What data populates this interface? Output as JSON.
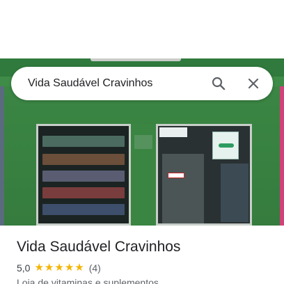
{
  "search": {
    "query": "Vida Saudável Cravinhos"
  },
  "place": {
    "name": "Vida Saudável Cravinhos",
    "rating": "5,0",
    "stars_filled": 5,
    "review_count": "(4)",
    "category": "Loja de vitaminas e suplementos"
  },
  "colors": {
    "star": "#f4b400",
    "storefront_green": "#3e8c47"
  },
  "icons": {
    "search": "search-icon",
    "close": "close-icon",
    "star": "star-icon"
  }
}
